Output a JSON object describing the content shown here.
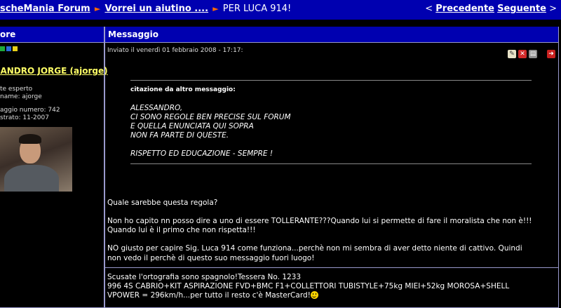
{
  "breadcrumb": {
    "forum": "scheMania Forum",
    "topic": "Vorrei un aiutino ....",
    "current": "PER LUCA 914!",
    "arrow": "►"
  },
  "pager": {
    "prev_arrow": "<",
    "prev": "Precedente",
    "next": "Seguente",
    "next_arrow": ">"
  },
  "table": {
    "author_header": "ore",
    "message_header": "Messaggio"
  },
  "author": {
    "name": "JANDRO JORGE (ajorge)",
    "rank": "te esperto",
    "nickname": "name: ajorge",
    "posts": "aggio numero: 742",
    "registered": "strato: 11-2007"
  },
  "post": {
    "posted": "Inviato il venerdì 01 febbraio 2008 - 17:17:",
    "quote": {
      "label": "citazione da altro messaggio:",
      "lines": [
        "ALESSANDRO,",
        "CI SONO REGOLE BEN PRECISE SUL FORUM",
        "E QUELLA ENUNCIATA QUI SOPRA",
        "NON FA PARTE DI QUESTE.",
        "",
        "RISPETTO ED EDUCAZIONE - SEMPRE !"
      ]
    },
    "body": [
      "Quale sarebbe questa regola?",
      "",
      "Non ho capito nn posso dire a uno di essere TOLLERANTE???Quando lui si permette di fare il moralista che non è!!!",
      "Quando lui è il primo che non rispetta!!!",
      "",
      "NO giusto per capire Sig. Luca 914 come funziona...perchè non mi sembra di aver detto niente di cattivo. Quindi",
      "non vedo il perchè di questo suo messaggio fuori luogo!"
    ],
    "signature": [
      "Scusate l'ortografia sono spagnolo!Tessera No. 1233",
      "996 4S CABRIO+KIT ASPIRAZIONE FVD+BMC F1+COLLETTORI TUBISTYLE+75kg MIEI+52kg MOROSA+SHELL",
      "VPOWER = 296km/h...per tutto il resto c'è MasterCard!"
    ]
  },
  "icons": {
    "edit": "edit-icon",
    "delete": "delete-icon",
    "print": "print-icon",
    "exit": "exit-icon"
  },
  "colors": {
    "header_blue": "#0000b0",
    "author_yellow": "#ffff66",
    "breadcrumb_arrow": "#ff6a00"
  }
}
